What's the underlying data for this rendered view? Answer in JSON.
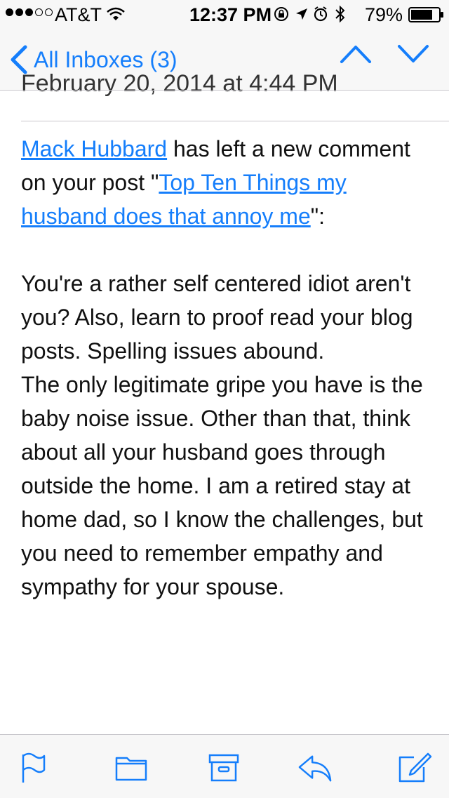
{
  "status_bar": {
    "carrier": "AT&T",
    "time": "12:37 PM",
    "battery_percent": "79%",
    "signal_bars_filled": 3,
    "signal_bars_total": 5,
    "battery_level": 0.79
  },
  "nav": {
    "back_label": "All Inboxes (3)",
    "prev_icon": "chevron-up-icon",
    "next_icon": "chevron-down-icon"
  },
  "email": {
    "date_line": "February 20, 2014 at 4:44 PM",
    "commenter": "Mack Hubbard",
    "intro_mid": " has left a new comment on your post \"",
    "post_title": "Top Ten Things my husband does that annoy me",
    "intro_end": "\":",
    "paragraph_1": "You're a rather self centered idiot aren't you? Also, learn to proof read your blog posts. Spelling issues abound.",
    "paragraph_2": "The only legitimate gripe you have is the baby noise issue. Other than that, think about all your husband goes through outside the home. I am a retired stay at home dad, so I know the challenges, but you need to remember empathy and sympathy for your spouse."
  },
  "toolbar": {
    "items": [
      "flag-icon",
      "folder-icon",
      "archive-icon",
      "reply-icon",
      "compose-icon"
    ]
  },
  "colors": {
    "accent": "#157efb",
    "bar_background": "#f7f7f7",
    "separator": "#c8c7cc"
  }
}
